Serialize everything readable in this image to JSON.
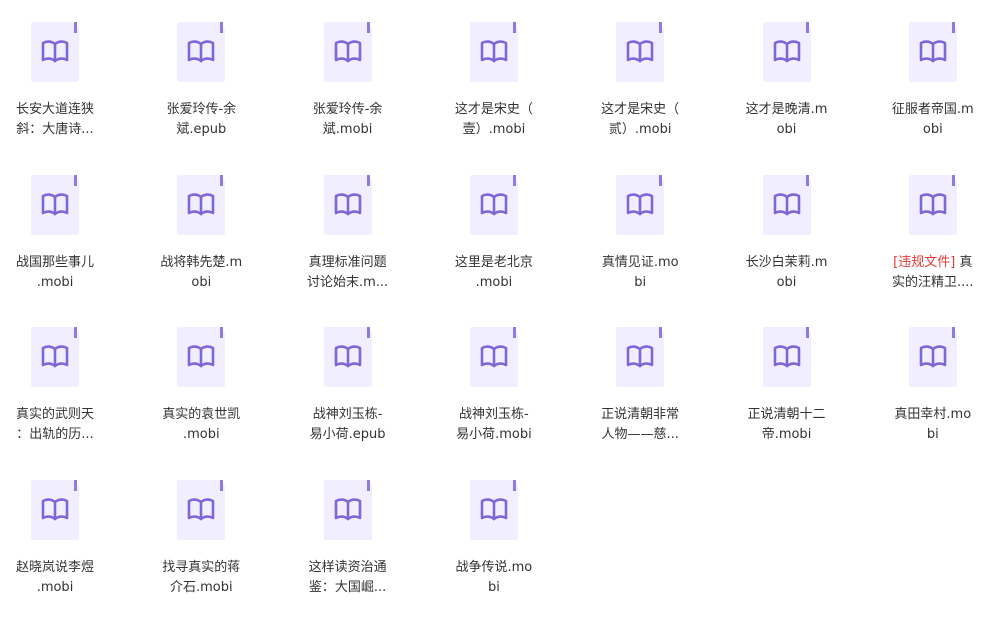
{
  "colors": {
    "icon_page": "#f1efff",
    "icon_fold": "#8f7ae0",
    "icon_book": "#8065d8",
    "text": "#333333",
    "tag": "#e53935"
  },
  "files": [
    {
      "line1": "长安大道连狭",
      "line2": "斜：大唐诗..."
    },
    {
      "line1": "张爱玲传-余",
      "line2": "斌.epub"
    },
    {
      "line1": "张爱玲传-余",
      "line2": "斌.mobi"
    },
    {
      "line1": "这才是宋史（",
      "line2": "壹）.mobi"
    },
    {
      "line1": "这才是宋史（",
      "line2": "贰）.mobi"
    },
    {
      "line1": "这才是晚清.m",
      "line2": "obi"
    },
    {
      "line1": "征服者帝国.m",
      "line2": "obi"
    },
    {
      "line1": "战国那些事儿",
      "line2": ".mobi"
    },
    {
      "line1": "战将韩先楚.m",
      "line2": "obi"
    },
    {
      "line1": "真理标准问题",
      "line2": "讨论始末.m..."
    },
    {
      "line1": "这里是老北京",
      "line2": ".mobi"
    },
    {
      "line1": "真情见证.mo",
      "line2": "bi"
    },
    {
      "line1": "长沙白茉莉.m",
      "line2": "obi"
    },
    {
      "tag": "[违规文件]",
      "line1": " 真",
      "line2": "实的汪精卫...."
    },
    {
      "line1": "真实的武则天",
      "line2": "：出轨的历..."
    },
    {
      "line1": "真实的袁世凯",
      "line2": ".mobi"
    },
    {
      "line1": "战神刘玉栋-",
      "line2": "易小荷.epub"
    },
    {
      "line1": "战神刘玉栋-",
      "line2": "易小荷.mobi"
    },
    {
      "line1": "正说清朝非常",
      "line2": "人物——慈..."
    },
    {
      "line1": "正说清朝十二",
      "line2": "帝.mobi"
    },
    {
      "line1": "真田幸村.mo",
      "line2": "bi"
    },
    {
      "line1": "赵晓岚说李煜",
      "line2": ".mobi"
    },
    {
      "line1": "找寻真实的蒋",
      "line2": "介石.mobi"
    },
    {
      "line1": "这样读资治通",
      "line2": "鉴：大国崛..."
    },
    {
      "line1": "战争传说.mo",
      "line2": "bi"
    }
  ]
}
